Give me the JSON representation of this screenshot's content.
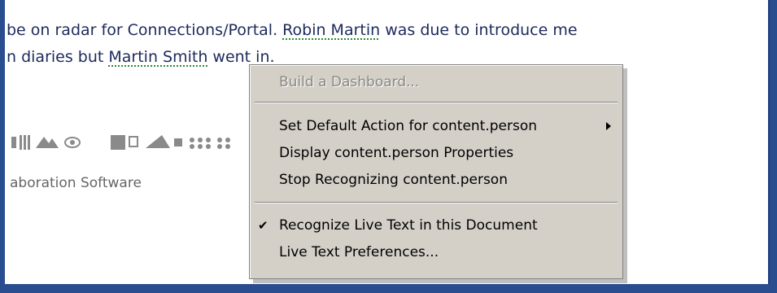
{
  "document": {
    "line1_pre": "be on radar for Connections/Portal. ",
    "line1_name": "Robin Martin",
    "line1_post": " was due to introduce me",
    "line2_pre": "n diaries but ",
    "line2_name": "Martin Smith",
    "line2_post": " went in.",
    "tagline": "aboration Software"
  },
  "context_menu": {
    "items": [
      {
        "label": "Build a Dashboard...",
        "enabled": false
      },
      {
        "label": "Set Default Action for content.person",
        "submenu": true
      },
      {
        "label": "Display content.person Properties"
      },
      {
        "label": "Stop Recognizing content.person"
      },
      {
        "label": "Recognize Live Text in this Document",
        "checked": true
      },
      {
        "label": "Live Text Preferences..."
      }
    ],
    "check_glyph": "✔"
  },
  "colors": {
    "window_frame": "#2a4d8f",
    "menu_bg": "#d4d0c8",
    "text": "#1d2a5c",
    "livetext_underline": "#2a8c2a"
  }
}
